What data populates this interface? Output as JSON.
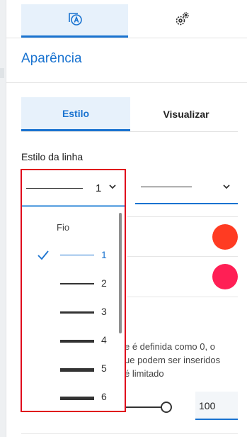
{
  "colors": {
    "accent": "#1a73d0",
    "highlight_border": "#e0001b",
    "swatch1": "#ff3b22",
    "swatch2": "#ff1f55"
  },
  "top_tabs": [
    {
      "icon": "text-format-icon",
      "active": true
    },
    {
      "icon": "gears-icon",
      "active": false
    }
  ],
  "title": "Aparência",
  "sub_tabs": [
    {
      "label": "Estilo",
      "active": true
    },
    {
      "label": "Visualizar",
      "active": false
    }
  ],
  "line_style": {
    "label": "Estilo da linha",
    "selected_value": "1",
    "group_label": "Fio",
    "options": [
      "1",
      "2",
      "3",
      "4",
      "5",
      "6"
    ],
    "selected_index": 0
  },
  "help_text": "e é definida como 0, o\nue podem ser inseridos\né limitado",
  "slider": {
    "value": "100"
  }
}
